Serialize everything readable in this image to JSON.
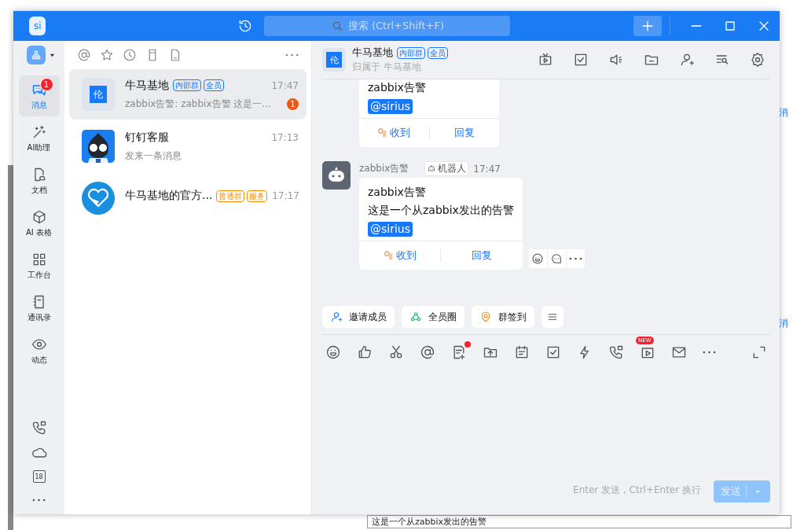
{
  "background": {
    "side_labels": [
      "消",
      "消"
    ],
    "field_value": "这是一个从zabbix发出的告警"
  },
  "title_bar": {
    "logo": "si",
    "search": {
      "placeholder": "搜索 (Ctrl+Shift+F)"
    }
  },
  "rail": {
    "items": [
      {
        "kind": "chat",
        "label": "消息",
        "selected": true,
        "badge": "1"
      },
      {
        "kind": "ai",
        "label": "AI助理",
        "selected": false
      },
      {
        "kind": "docs",
        "label": "文档",
        "selected": false
      },
      {
        "kind": "table",
        "label": "AI 表格",
        "selected": false
      },
      {
        "kind": "grid",
        "label": "工作台",
        "selected": false
      },
      {
        "kind": "contacts",
        "label": "通讯录",
        "selected": false
      },
      {
        "kind": "eye",
        "label": "动态",
        "selected": false
      }
    ],
    "calendar_day": "18"
  },
  "conversations": [
    {
      "kind": "group",
      "avatar_text": "伦",
      "name": "牛马基地",
      "tags": [
        {
          "text": "内部群",
          "color": "#1677ff"
        },
        {
          "text": "全员",
          "color": "#1677ff"
        }
      ],
      "time": "17:47",
      "preview": "zabbix告警: zabbix告警 这是一...",
      "unread": "1",
      "selected": true
    },
    {
      "kind": "picture",
      "name": "钉钉客服",
      "time": "17:13",
      "preview": "发来一条消息",
      "selected": false
    },
    {
      "kind": "heart",
      "name": "牛马基地的官方...",
      "tags": [
        {
          "text": "普通群",
          "color": "#ff8a00"
        },
        {
          "text": "服务",
          "color": "#ff8a00"
        }
      ],
      "time": "17:17",
      "selected": false
    }
  ],
  "chat": {
    "avatar_text": "伦",
    "title": "牛马基地",
    "tags": [
      {
        "text": "内部群",
        "color": "#1677ff"
      },
      {
        "text": "全员",
        "color": "#1677ff"
      }
    ],
    "subtitle": "归属于 牛马基地",
    "messages": [
      {
        "kind": "partial",
        "lines": [
          "zabbix告警"
        ],
        "mention": "@sirius",
        "actions": [
          "收到",
          "回复"
        ]
      },
      {
        "kind": "full",
        "sender": "zabbix告警",
        "sender_badge": "机器人",
        "time": "17:47",
        "lines": [
          "zabbix告警",
          "这是一个从zabbix发出的告警"
        ],
        "mention": "@sirius",
        "actions": [
          "收到",
          "回复"
        ],
        "hover_tools": true
      }
    ],
    "quick_actions": [
      {
        "kind": "invite",
        "label": "邀请成员"
      },
      {
        "kind": "circle",
        "label": "全员圈"
      },
      {
        "kind": "checkin",
        "label": "群签到"
      }
    ],
    "tools": [
      {
        "kind": "emoji"
      },
      {
        "kind": "thumb"
      },
      {
        "kind": "scissors"
      },
      {
        "kind": "at"
      },
      {
        "kind": "note",
        "dot": true
      },
      {
        "kind": "upload"
      },
      {
        "kind": "calendar"
      },
      {
        "kind": "checkbox"
      },
      {
        "kind": "lightning"
      },
      {
        "kind": "phone"
      },
      {
        "kind": "video",
        "badge": "NEW"
      },
      {
        "kind": "mail"
      },
      {
        "kind": "more"
      }
    ],
    "input": {
      "placeholder": "Enter 发送 , Ctrl+Enter 换行"
    },
    "send": {
      "label": "发送",
      "disabled": true
    }
  }
}
